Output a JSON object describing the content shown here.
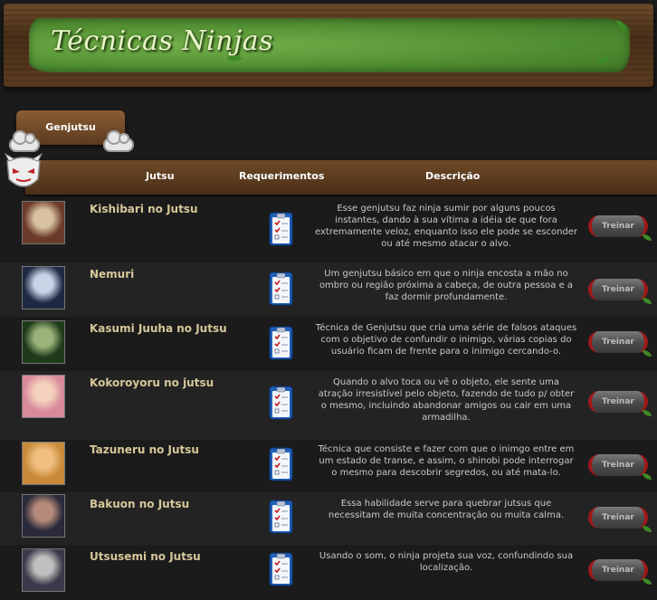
{
  "banner": {
    "title": "Técnicas Ninjas"
  },
  "category": {
    "label": "Genjutsu"
  },
  "table": {
    "headers": {
      "jutsu": "Jutsu",
      "requirements": "Requerimentos",
      "description": "Descrição"
    },
    "rows": [
      {
        "name": "Kishibari no Jutsu",
        "description": "Esse genjutsu faz ninja sumir por alguns poucos instantes, dando à sua vítima a idéia de que fora extremamente veloz, enquanto isso ele pode se esconder ou até mesmo atacar o alvo.",
        "button": "Treinar"
      },
      {
        "name": "Nemuri",
        "description": "Um genjutsu básico em que o ninja encosta a mão no ombro ou região próxima a cabeça, de outra pessoa e a faz dormir profundamente.",
        "button": "Treinar"
      },
      {
        "name": "Kasumi Juuha no Jutsu",
        "description": "Técnica de Genjutsu que cria uma série de falsos ataques com o objetivo de confundir o inimigo, várias copias do usuário ficam de frente para o inimigo cercando-o.",
        "button": "Treinar"
      },
      {
        "name": "Kokoroyoru no jutsu",
        "description": "Quando o alvo toca ou vê o objeto, ele sente uma atração irresistível pelo objeto, fazendo de tudo p/ obter o mesmo, incluindo abandonar amigos ou cair em uma armadilha.",
        "button": "Treinar"
      },
      {
        "name": "Tazuneru no Jutsu",
        "description": "Técnica que consiste e fazer com que o inimgo entre em um estado de transe, e assim, o shinobi pode interrogar o mesmo para descobrir segredos, ou até mata-lo.",
        "button": "Treinar"
      },
      {
        "name": "Bakuon no Jutsu",
        "description": "Essa habilidade serve para quebrar jutsus que necessitam de muita concentração ou muita calma.",
        "button": "Treinar"
      },
      {
        "name": "Utsusemi no Jutsu",
        "description": "Usando o som, o ninja projeta sua voz, confundindo sua localização.",
        "button": "Treinar"
      }
    ]
  }
}
